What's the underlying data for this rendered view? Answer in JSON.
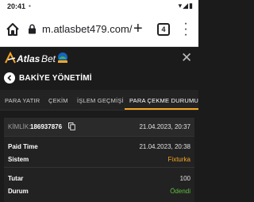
{
  "statusbar": {
    "time": "20:41"
  },
  "browser": {
    "url": "m.atlasbet479.com/",
    "tab_count": "4"
  },
  "app": {
    "logo_text": "AtlasBet"
  },
  "page": {
    "title": "BAKİYE YÖNETİMİ"
  },
  "tabs": [
    {
      "label": "PARA YATIR",
      "active": false
    },
    {
      "label": "ÇEKİM",
      "active": false
    },
    {
      "label": "İŞLEM GEÇMİŞİ",
      "active": false
    },
    {
      "label": "PARA ÇEKME DURUMU",
      "active": true
    }
  ],
  "transaction": {
    "id_label": "KİMLİK:",
    "id_value": "186937876",
    "created": "21.04.2023, 20:37",
    "rows": [
      {
        "label": "Paid Time",
        "value": "21.04.2023, 20:38"
      },
      {
        "label": "Sistem",
        "value": "Fixturka"
      },
      {
        "label": "Tutar",
        "value": "100"
      },
      {
        "label": "Durum",
        "value": "Ödendi"
      }
    ]
  },
  "colors": {
    "accent": "#f5a623",
    "success": "#5fbf3f",
    "background": "#1b1b1b"
  }
}
